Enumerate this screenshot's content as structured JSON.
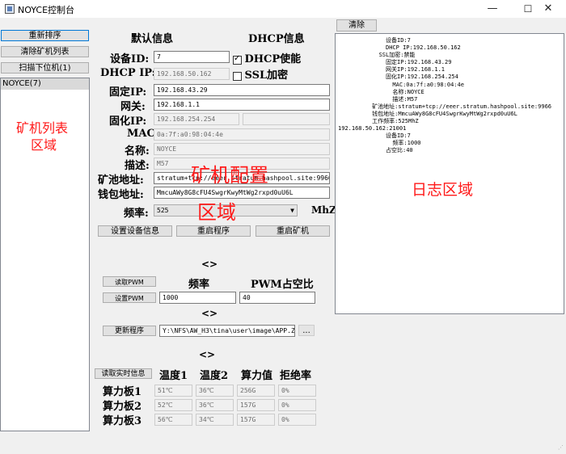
{
  "window": {
    "title": "NOYCE控制台",
    "min": "—",
    "max": "☐",
    "close": "✕"
  },
  "sidebar": {
    "reorder_btn": "重新排序",
    "clear_btn": "清除矿机列表",
    "scan_btn": "扫描下位机(1)",
    "miners": [
      "NOYCE(7)"
    ],
    "area_label_1": "矿机列表",
    "area_label_2": "区域"
  },
  "config": {
    "default_header": "默认信息",
    "dhcp_header": "DHCP信息",
    "device_id_label": "设备ID:",
    "device_id": "7",
    "dhcp_enable_label": "DHCP使能",
    "dhcp_enable": true,
    "ssl_label": "SSL加密",
    "ssl": false,
    "dhcp_ip_label": "DHCP IP:",
    "dhcp_ip": "192.168.50.162",
    "fixed_ip_label": "固定IP:",
    "fixed_ip": "192.168.43.29",
    "gateway_label": "网关:",
    "gateway": "192.168.1.1",
    "solid_ip_label": "固化IP:",
    "solid_ip": "192.168.254.254",
    "mac_label": "MAC:",
    "mac": "0a:7f:a0:98:04:4e",
    "name_label": "名称:",
    "name": "NOYCE",
    "desc_label": "描述:",
    "desc": "M57",
    "pool_label": "矿池地址:",
    "pool": "stratum+tcp://eeer.stratum.hashpool.site:9966",
    "wallet_label": "钱包地址:",
    "wallet": "MmcuAWy8G8cFU4SwgrKwyMtWg2rxpd0uU6L",
    "freq_label": "频率:",
    "freq": "525",
    "freq_unit": "MhZ",
    "set_btn": "设置设备信息",
    "restart_prog_btn": "重启程序",
    "restart_miner_btn": "重启矿机",
    "area_label_1": "矿机配置",
    "area_label_2": "区域"
  },
  "pwm": {
    "nav": "<>",
    "read_btn": "读取PWM",
    "set_btn": "设置PWM",
    "freq_header": "频率",
    "duty_header": "PWM占空比",
    "freq": "1000",
    "duty": "40"
  },
  "update": {
    "nav": "<>",
    "btn": "更新程序",
    "path": "Y:\\NFS\\AW_H3\\tina\\user\\image\\APP.ZT",
    "browse": "..."
  },
  "realtime": {
    "nav": "<>",
    "btn": "读取实时信息",
    "headers": [
      "温度1",
      "温度2",
      "算力值",
      "拒绝率"
    ],
    "rows": [
      {
        "label": "算力板1",
        "t1": "51℃",
        "t2": "36℃",
        "hash": "256G",
        "rej": "0%"
      },
      {
        "label": "算力板2",
        "t1": "52℃",
        "t2": "36℃",
        "hash": "157G",
        "rej": "0%"
      },
      {
        "label": "算力板3",
        "t1": "56℃",
        "t2": "34℃",
        "hash": "157G",
        "rej": "0%"
      }
    ]
  },
  "log": {
    "clear_btn": "清除",
    "area_label": "日志区域",
    "lines": [
      "              设备ID:7",
      "              DHCP IP:192.168.50.162",
      "            SSL加密:禁能",
      "              固定IP:192.168.43.29",
      "              网关IP:192.168.1.1",
      "              固化IP:192.168.254.254",
      "                MAC:0a:7f:a0:98:04:4e",
      "                名称:NOYCE",
      "                描述:M57",
      "          矿池地址:stratum+tcp://eeer.stratum.hashpool.site:9966",
      "          钱包地址:MmcuAWy8G8cFU4SwgrKwyMtWg2rxpd0uU6L",
      "          工作频率:525MhZ",
      "192.168.50.162:21001",
      "              设备ID:7",
      "                频率:1000",
      "              占空比:40"
    ]
  }
}
